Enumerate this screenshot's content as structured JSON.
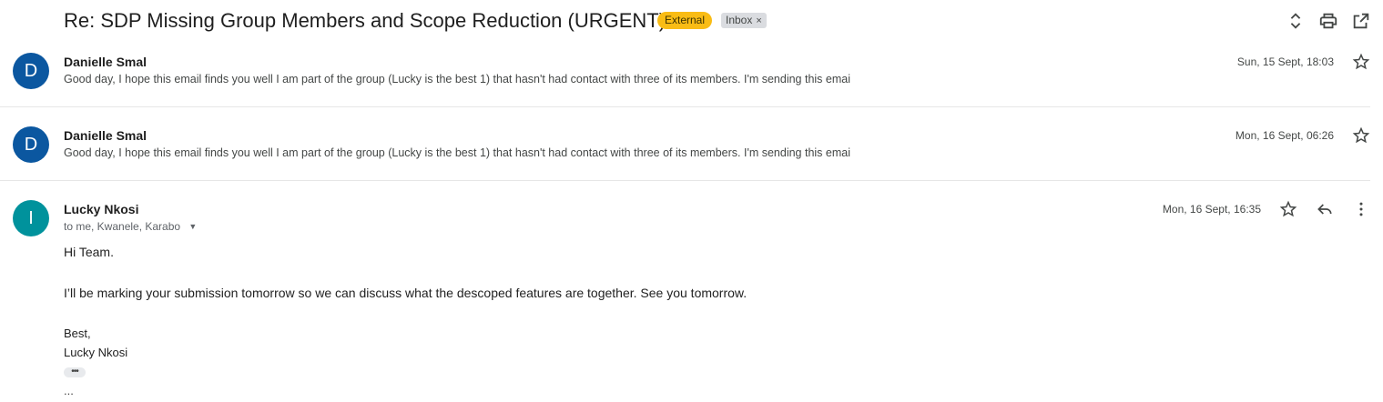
{
  "thread": {
    "subject": "Re: SDP Missing Group Members and Scope Reduction (URGENT)",
    "labels": {
      "external": "External",
      "inbox": "Inbox",
      "inbox_close": "×"
    },
    "header_icons": [
      "expand-collapse-icon",
      "print-icon",
      "open-in-new-window-icon"
    ]
  },
  "messages": [
    {
      "avatar_letter": "D",
      "avatar_color": "#0b57a0",
      "sender": "Danielle Smal",
      "date": "Sun, 15 Sept, 18:03",
      "snippet": "Good day, I hope this email finds you well I am part of the group (Lucky is the best 1) that hasn't had contact with three of its members. I'm sending this emai"
    },
    {
      "avatar_letter": "D",
      "avatar_color": "#0b57a0",
      "sender": "Danielle Smal",
      "date": "Mon, 16 Sept, 06:26",
      "snippet": "Good day, I hope this email finds you well I am part of the group (Lucky is the best 1) that hasn't had contact with three of its members. I'm sending this emai"
    },
    {
      "avatar_letter": "I",
      "avatar_color": "#00929c",
      "sender": "Lucky Nkosi",
      "date": "Mon, 16 Sept, 16:35",
      "to": "to me, Kwanele, Karabo",
      "body": {
        "greeting": "Hi Team.",
        "paragraph": "I’ll be marking your submission tomorrow so we can discuss what the descoped features are together. See you tomorrow.",
        "sign_off": "Best,",
        "signature_name": "Lucky Nkosi",
        "show_trimmed": "•••",
        "trailing": "..."
      }
    }
  ]
}
